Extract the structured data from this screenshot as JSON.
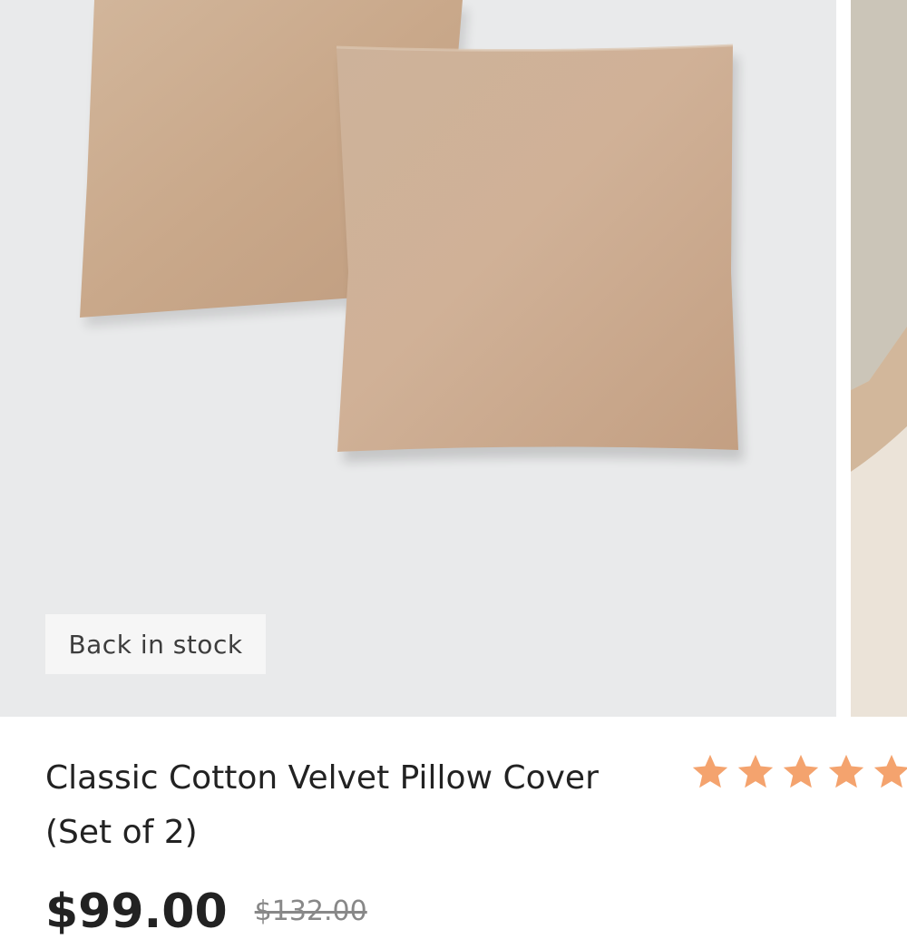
{
  "product": {
    "badge": "Back in stock",
    "title_line1": "Classic Cotton Velvet Pillow Cover",
    "title_line2": "(Set of 2)",
    "rating_stars": 5,
    "price": "$99.00",
    "compare_price": "$132.00"
  },
  "colors": {
    "star": "#f4a36e",
    "pillow": "#c9a98c",
    "image_background": "#e9eaeb"
  },
  "icons": [
    "star-icon"
  ]
}
